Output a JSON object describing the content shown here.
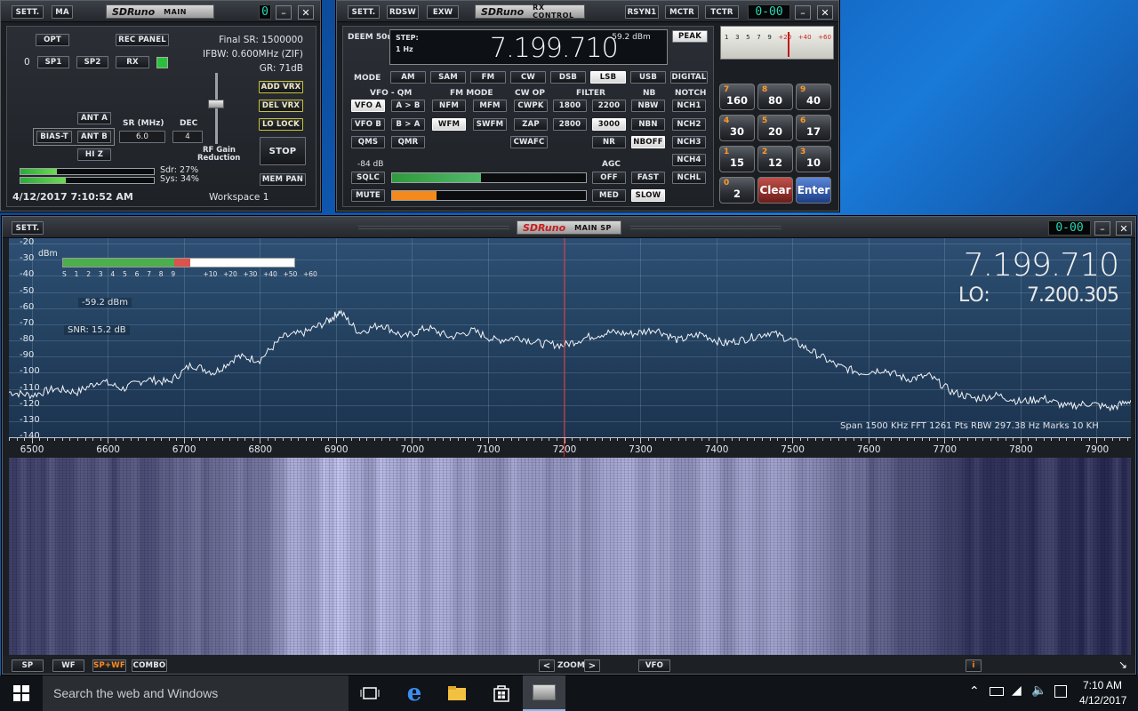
{
  "main_win": {
    "sett": "SETT.",
    "ma": "MA",
    "logo": "SDRuno",
    "logo_sub": "MAIN",
    "digit": "0",
    "opt": "OPT",
    "rec_panel": "REC PANEL",
    "final_sr": "Final SR: 1500000",
    "ifbw": "IFBW: 0.600MHz (ZIF)",
    "gr": "GR: 71dB",
    "zero": "0",
    "sp1": "SP1",
    "sp2": "SP2",
    "rx": "RX",
    "add_vrx": "ADD VRX",
    "del_vrx": "DEL VRX",
    "lo_lock": "LO LOCK",
    "ant_a": "ANT A",
    "ant_b": "ANT B",
    "bias_t": "BIAS-T",
    "sr_label": "SR (MHz)",
    "sr_value": "6.0",
    "dec_label": "DEC",
    "dec_value": "4",
    "hi_z": "HI Z",
    "rf_gain": "RF Gain",
    "reduction": "Reduction",
    "stop": "STOP",
    "mem_pan": "MEM PAN",
    "sdr": "Sdr: 27%",
    "sys": "Sys: 34%",
    "sdr_level": 0.27,
    "sys_level": 0.34,
    "datetime": "4/12/2017 7:10:52 AM",
    "workspace": "Workspace 1"
  },
  "rx_win": {
    "sett": "SETT.",
    "rdsw": "RDSW",
    "exw": "EXW",
    "logo": "SDRuno",
    "logo_sub": "RX CONTROL",
    "rsyn1": "RSYN1",
    "mctr": "MCTR",
    "tctr": "TCTR",
    "digits": "0-00",
    "deem": "DEEM 50u",
    "step": "STEP:",
    "step_val": "1 Hz",
    "freq": "7.199.710",
    "dbm": "-59.2 dBm",
    "peak": "PEAK",
    "mode": "MODE",
    "modes": [
      "AM",
      "SAM",
      "FM",
      "CW",
      "DSB",
      "LSB",
      "USB",
      "DIGITAL"
    ],
    "vfo_qm": "VFO - QM",
    "fm_mode": "FM MODE",
    "cw_op": "CW OP",
    "filter": "FILTER",
    "nb": "NB",
    "notch": "NOTCH",
    "vfo_a": "VFO A",
    "a_b": "A > B",
    "nfm": "NFM",
    "mfm": "MFM",
    "cwpk": "CWPK",
    "f1800": "1800",
    "f2200": "2200",
    "nbw": "NBW",
    "nch1": "NCH1",
    "vfo_b": "VFO B",
    "b_a": "B > A",
    "wfm": "WFM",
    "swfm": "SWFM",
    "zap": "ZAP",
    "f2800": "2800",
    "f3000": "3000",
    "nbn": "NBN",
    "nch2": "NCH2",
    "qms": "QMS",
    "qmr": "QMR",
    "cwafc": "CWAFC",
    "nr": "NR",
    "nboff": "NBOFF",
    "nch3": "NCH3",
    "nch4": "NCH4",
    "sq_db": "-84 dB",
    "agc": "AGC",
    "sqlc": "SQLC",
    "off": "OFF",
    "fast": "FAST",
    "nchl": "NCHL",
    "mute": "MUTE",
    "med": "MED",
    "slow": "SLOW",
    "sq_level": 0.46,
    "vol_level": 0.23,
    "keypad": [
      {
        "sub": "7",
        "main": "160"
      },
      {
        "sub": "8",
        "main": "80"
      },
      {
        "sub": "9",
        "main": "40"
      },
      {
        "sub": "4",
        "main": "30"
      },
      {
        "sub": "5",
        "main": "20"
      },
      {
        "sub": "6",
        "main": "17"
      },
      {
        "sub": "1",
        "main": "15"
      },
      {
        "sub": "2",
        "main": "12"
      },
      {
        "sub": "3",
        "main": "10"
      },
      {
        "sub": "0",
        "main": "2"
      },
      {
        "sub": "",
        "main": "Clear"
      },
      {
        "sub": "",
        "main": "Enter"
      }
    ],
    "meter_scale": [
      "1",
      "3",
      "5",
      "7",
      "9",
      "+20",
      "+40",
      "+60"
    ]
  },
  "sp_win": {
    "sett": "SETT.",
    "logo": "SDRuno",
    "logo_sub": "MAIN SP",
    "digits": "0-00",
    "dbm_unit": "dBm",
    "s_scale": [
      "S",
      "1",
      "2",
      "3",
      "4",
      "5",
      "6",
      "7",
      "8",
      "9",
      "+10",
      "+20",
      "+30",
      "+40",
      "+50",
      "+60"
    ],
    "level_readout": "-59.2 dBm",
    "snr": "SNR: 15.2 dB",
    "big_freq": "7.199.710",
    "lo_label": "LO:",
    "lo_freq": "7.200.305",
    "span_info": "Span 1500 KHz   FFT 1261 Pts   RBW 297.38 Hz   Marks 10 KH",
    "sp": "SP",
    "wf": "WF",
    "spwf": "SP+WF",
    "combo": "COMBO",
    "zoom": "ZOOM",
    "vfo": "VFO",
    "info": "i",
    "arrow_left": "<",
    "arrow_right": ">",
    "resize": "↘",
    "s_meter_level": 0.55
  },
  "chart_data": {
    "type": "line",
    "title": "",
    "xlabel": "",
    "ylabel": "dBm",
    "xlim": [
      6470,
      7945
    ],
    "ylim": [
      -140,
      -20
    ],
    "x_ticks": [
      "6500",
      "6600",
      "6700",
      "6800",
      "6900",
      "7000",
      "7100",
      "7200",
      "7300",
      "7400",
      "7500",
      "7600",
      "7700",
      "7800",
      "7900"
    ],
    "y_ticks": [
      "-20",
      "-30",
      "-40",
      "-50",
      "-60",
      "-70",
      "-80",
      "-90",
      "-100",
      "-110",
      "-120",
      "-130",
      "-140"
    ],
    "vfo_marker_khz": 7199.71,
    "series": [
      {
        "x": [
          6470,
          6500,
          6530,
          6560,
          6590,
          6620,
          6650,
          6680,
          6710,
          6740,
          6770,
          6800,
          6830,
          6860,
          6890,
          6905,
          6930,
          6960,
          6990,
          7020,
          7050,
          7080,
          7110,
          7140,
          7170,
          7200,
          7230,
          7260,
          7290,
          7320,
          7350,
          7380,
          7410,
          7440,
          7470,
          7500,
          7530,
          7560,
          7590,
          7620,
          7650,
          7680,
          7710,
          7740,
          7770,
          7800,
          7830,
          7860,
          7890,
          7920,
          7945
        ],
        "y": [
          -112,
          -114,
          -110,
          -112,
          -105,
          -110,
          -104,
          -106,
          -95,
          -100,
          -90,
          -92,
          -78,
          -75,
          -68,
          -62,
          -75,
          -70,
          -78,
          -72,
          -78,
          -74,
          -80,
          -78,
          -82,
          -83,
          -78,
          -75,
          -76,
          -73,
          -80,
          -76,
          -82,
          -79,
          -75,
          -80,
          -88,
          -96,
          -100,
          -98,
          -104,
          -102,
          -112,
          -116,
          -114,
          -118,
          -116,
          -121,
          -119,
          -122,
          -117
        ]
      }
    ]
  },
  "taskbar": {
    "search": "Search the web and Windows",
    "time": "7:10 AM",
    "date": "4/12/2017"
  }
}
